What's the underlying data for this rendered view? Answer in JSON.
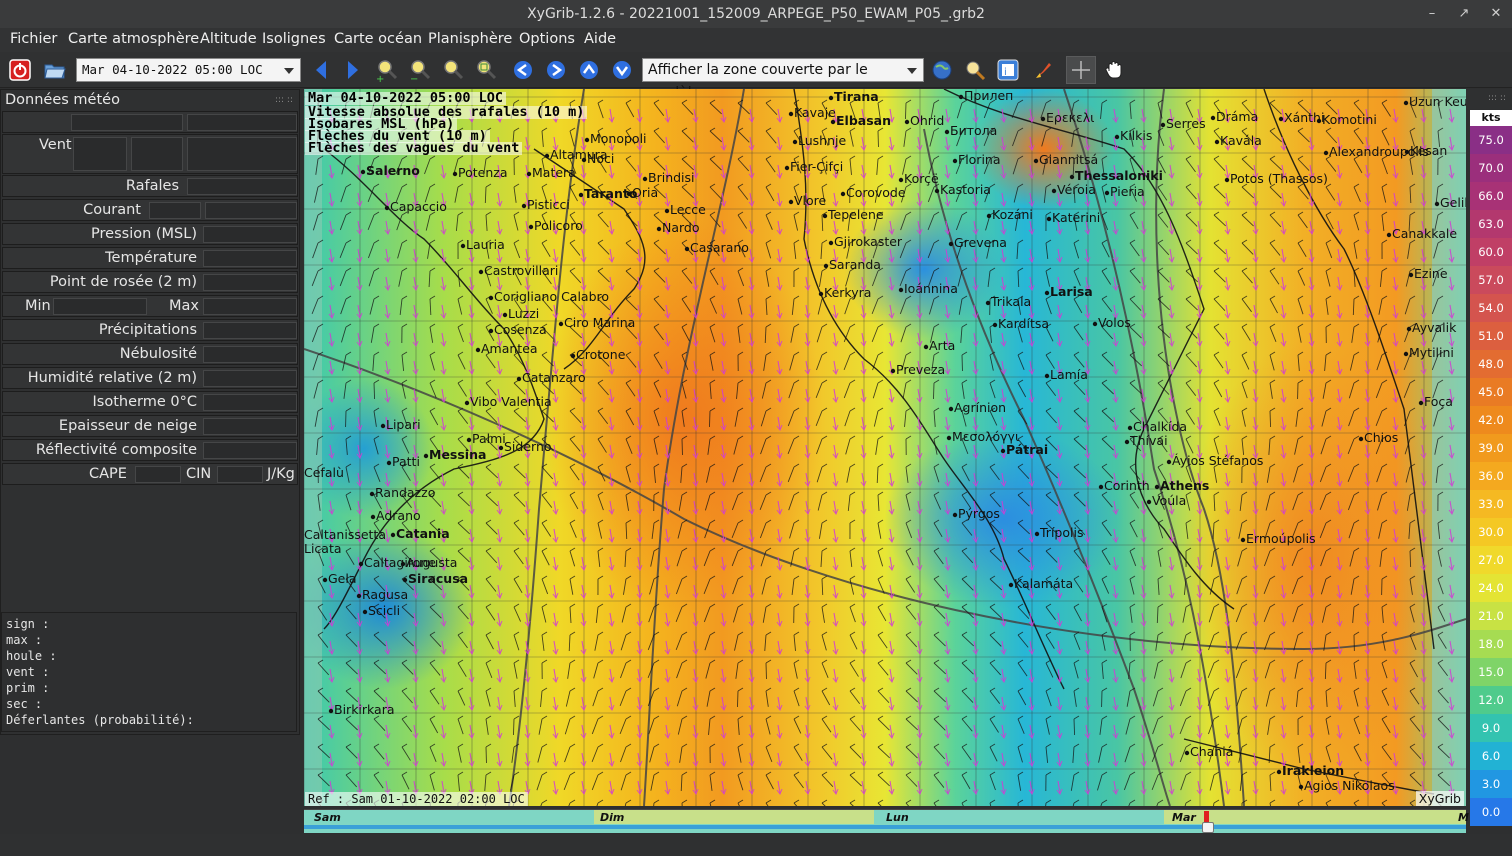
{
  "window": {
    "title": "XyGrib-1.2.6 - 20221001_152009_ARPEGE_P50_EWAM_P05_.grb2"
  },
  "menu": [
    "Fichier",
    "Carte atmosphère",
    "Altitude",
    "Isolignes",
    "Carte océan",
    "Planisphère",
    "Options",
    "Aide"
  ],
  "toolbar": {
    "date_select": "Mar 04-10-2022 05:00 LOC",
    "zone_select": "Afficher la zone couverte par le modèle"
  },
  "panel": {
    "title": "Données météo",
    "rows": [
      "Vent",
      "Rafales",
      "Courant",
      "Pression (MSL)",
      "Température",
      "Point de rosée (2 m)",
      "Min",
      "Max",
      "Précipitations",
      "Nébulosité",
      "Humidité relative (2 m)",
      "Isotherme 0°C",
      "Epaisseur de neige",
      "Réflectivité composite",
      "CAPE",
      "CIN",
      "J/Kg"
    ],
    "wave_lines": [
      "sign :",
      "max :",
      "houle :",
      "vent :",
      "prim :",
      "sec :",
      "Déferlantes (probabilité):"
    ]
  },
  "map": {
    "overlay": [
      "Mar 04-10-2022 05:00 LOC",
      "Vitesse absolue des rafales (10 m)",
      "Isobares MSL (hPa)",
      "Flèches du vent (10 m)",
      "Flèches des vagues du vent"
    ],
    "ref": "Ref : Sam 01-10-2022 02:00 LOC",
    "brand": "XyGrib",
    "cities": [
      {
        "n": "Tirana",
        "b": true
      },
      {
        "n": "Прилеп"
      },
      {
        "n": "Uzun Keu"
      },
      {
        "n": "Kavaje"
      },
      {
        "n": "Elbasan",
        "b": true
      },
      {
        "n": "Ohrid"
      },
      {
        "n": "Битола"
      },
      {
        "n": "Eρεκελι"
      },
      {
        "n": "Serres"
      },
      {
        "n": "Dráma"
      },
      {
        "n": "Xánthi"
      },
      {
        "n": "Komotini"
      },
      {
        "n": "Monopoli"
      },
      {
        "n": "Noci"
      },
      {
        "n": "Altamura"
      },
      {
        "n": "Lushnje"
      },
      {
        "n": "Kilkis"
      },
      {
        "n": "Kavála"
      },
      {
        "n": "Alexandroupolis"
      },
      {
        "n": "Kesan"
      },
      {
        "n": "Salerno",
        "b": true
      },
      {
        "n": "Potenza"
      },
      {
        "n": "Matera"
      },
      {
        "n": "Brindisi"
      },
      {
        "n": "Fier-Çifçi"
      },
      {
        "n": "Korçë"
      },
      {
        "n": "Florina"
      },
      {
        "n": "Giannitsá"
      },
      {
        "n": "Thessaloniki",
        "b": true
      },
      {
        "n": "Potos (Thassos)"
      },
      {
        "n": "Taranto",
        "b": true
      },
      {
        "n": "Oria"
      },
      {
        "n": "Corovode"
      },
      {
        "n": "Kastoria"
      },
      {
        "n": "Véroia"
      },
      {
        "n": "Pieria"
      },
      {
        "n": "Capaccio"
      },
      {
        "n": "Pisticci"
      },
      {
        "n": "Lecce"
      },
      {
        "n": "Vlore"
      },
      {
        "n": "Tepelene"
      },
      {
        "n": "Kozáni"
      },
      {
        "n": "Katerini"
      },
      {
        "n": "Gelibolu"
      },
      {
        "n": "Policoro"
      },
      {
        "n": "Nardo"
      },
      {
        "n": "Gjirokaster"
      },
      {
        "n": "Grevena"
      },
      {
        "n": "Canakkale"
      },
      {
        "n": "Lauria"
      },
      {
        "n": "Casarano"
      },
      {
        "n": "Saranda"
      },
      {
        "n": "Ezine"
      },
      {
        "n": "Castrovillari"
      },
      {
        "n": "Kerkyra"
      },
      {
        "n": "Ioánnina"
      },
      {
        "n": "Trikala"
      },
      {
        "n": "Larisa",
        "b": true
      },
      {
        "n": "Corigliano Calabro"
      },
      {
        "n": "Luzzi"
      },
      {
        "n": "Ciro Marina"
      },
      {
        "n": "Kardítsa"
      },
      {
        "n": "Volos"
      },
      {
        "n": "Cosenza"
      },
      {
        "n": "Ayvalik"
      },
      {
        "n": "Amantea"
      },
      {
        "n": "Crotone"
      },
      {
        "n": "Arta"
      },
      {
        "n": "Mytilini"
      },
      {
        "n": "Catanzaro"
      },
      {
        "n": "Preveza"
      },
      {
        "n": "Lamía"
      },
      {
        "n": "Vibo Valentia"
      },
      {
        "n": "Agrínion"
      },
      {
        "n": "Foça"
      },
      {
        "n": "Lipari"
      },
      {
        "n": "Mεσολόγγι"
      },
      {
        "n": "Chalkída"
      },
      {
        "n": "Palmi"
      },
      {
        "n": "Thívai"
      },
      {
        "n": "Chios"
      },
      {
        "n": "Siderno"
      },
      {
        "n": "Pátrai",
        "b": true
      },
      {
        "n": "Patti"
      },
      {
        "n": "Messina",
        "b": true
      },
      {
        "n": "Áyios Stéfanos"
      },
      {
        "n": "Cefalù"
      },
      {
        "n": "Athens",
        "b": true
      },
      {
        "n": "Corinth"
      },
      {
        "n": "Voúla"
      },
      {
        "n": "Randazzo"
      },
      {
        "n": "Adrano"
      },
      {
        "n": "Pýrgos"
      },
      {
        "n": "Catania",
        "b": true
      },
      {
        "n": "Trípolis"
      },
      {
        "n": "Ermoúpolis"
      },
      {
        "n": "Caltanissetta"
      },
      {
        "n": "Licata"
      },
      {
        "n": "Caltagirone"
      },
      {
        "n": "Augusta"
      },
      {
        "n": "Gela"
      },
      {
        "n": "Siracusa",
        "b": true
      },
      {
        "n": "Kalamáta"
      },
      {
        "n": "Ragusa"
      },
      {
        "n": "Scicli"
      },
      {
        "n": "Birkirkara"
      },
      {
        "n": "Chaniá"
      },
      {
        "n": "Irakleion",
        "b": true
      },
      {
        "n": "Agios Nikolaos"
      }
    ]
  },
  "legend": {
    "unit": "kts",
    "values": [
      "75.0",
      "70.0",
      "66.0",
      "63.0",
      "60.0",
      "57.0",
      "54.0",
      "51.0",
      "48.0",
      "45.0",
      "42.0",
      "39.0",
      "36.0",
      "33.0",
      "30.0",
      "27.0",
      "24.0",
      "21.0",
      "18.0",
      "15.0",
      "12.0",
      "9.0",
      "6.0",
      "3.0",
      "0.0"
    ],
    "colors": [
      "#8a2f86",
      "#9b2f7c",
      "#a83276",
      "#b3386e",
      "#c03f66",
      "#ca4a5c",
      "#d4544e",
      "#dc5f3f",
      "#e36c31",
      "#e97b24",
      "#ee8a1d",
      "#f19a1d",
      "#f4a91f",
      "#f5b922",
      "#f4c824",
      "#f0d92b",
      "#e4e434",
      "#c8e244",
      "#a6dc52",
      "#7fd468",
      "#4fcb8c",
      "#33c3b0",
      "#22b2d4",
      "#2197e2",
      "#2678e8"
    ]
  },
  "timeline": {
    "days": [
      "Sam",
      "Dim",
      "Lun",
      "Mar",
      "M"
    ]
  }
}
